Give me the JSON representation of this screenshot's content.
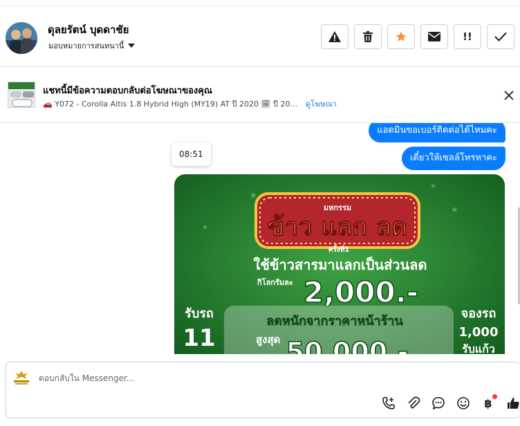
{
  "header": {
    "contact_name": "ดุลยรัตน์ บุดดาชัย",
    "assign_label": "มอบหมายการสนทนานี้",
    "actions": [
      {
        "name": "report-button",
        "icon": "warning-icon"
      },
      {
        "name": "delete-button",
        "icon": "trash-icon"
      },
      {
        "name": "star-button",
        "icon": "star-icon",
        "color": "#f7923b"
      },
      {
        "name": "mark-unread-button",
        "icon": "envelope-icon"
      },
      {
        "name": "mark-spam-button",
        "icon": "double-exclamation-icon",
        "text": "!!"
      },
      {
        "name": "mark-done-button",
        "icon": "check-icon"
      }
    ]
  },
  "ad": {
    "title": "แชทนี้มีข้อความตอบกลับต่อโฆษณาของคุณ",
    "subtitle": "🚗 Y072 - Corolla Altis 1.8 Hybrid High (MY19) AT ปี 2020 🗓 ปี 20...",
    "link_label": "ดูโฆษณา"
  },
  "chat": {
    "messages": [
      {
        "text": "แอดมินขอเบอร์ติดต่อได้ไหมคะ"
      },
      {
        "text": "เดี๋ยวให้เซลล์โทรหาคะ"
      }
    ],
    "timestamp": "08:51",
    "promo_image": {
      "event_small": "มหกรรม",
      "headline": "ข้าว แลก ลด",
      "edition": "ครั้งที่1",
      "line1": "ใช้ข้าวสารมาแลกเป็นส่วนลด",
      "per_kg": "กิโลกรัมละ",
      "per_kg_value": "2,000.-",
      "discount_line": "ลดหนักจากราคาหน้าร้าน",
      "max_label": "สูงสุด",
      "max_value": "50,000.-",
      "left_label": "รับรถ",
      "left_value": "11",
      "right_label": "จองรถ",
      "right_value": "1,000",
      "right_tail": "รับแก้ว"
    }
  },
  "composer": {
    "placeholder": "ตอบกลับใน Messenger...",
    "tools": [
      "call-add-icon",
      "attachment-icon",
      "saved-reply-icon",
      "emoji-icon",
      "baht-icon",
      "thumbs-up-icon"
    ],
    "baht_symbol": "฿"
  },
  "colors": {
    "accent": "#0a7cff",
    "star": "#f7923b",
    "link": "#1877f2",
    "promo_green": "#1f7a2b"
  }
}
